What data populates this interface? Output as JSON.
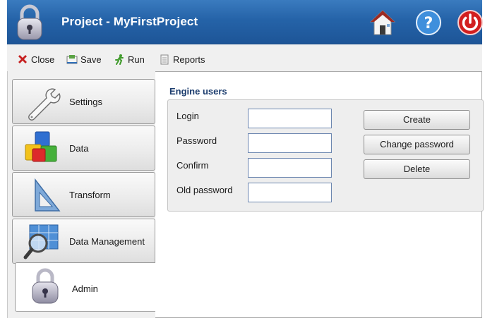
{
  "window": {
    "title": "Project - MyFirstProject",
    "icons": {
      "app": "padlock-icon",
      "home": "home-icon",
      "help": "help-icon",
      "power": "power-icon"
    }
  },
  "toolbar": {
    "close_label": "Close",
    "save_label": "Save",
    "run_label": "Run",
    "reports_label": "Reports"
  },
  "sidebar": {
    "items": [
      {
        "label": "Settings",
        "icon": "wrench-icon"
      },
      {
        "label": "Data",
        "icon": "cubes-icon"
      },
      {
        "label": "Transform",
        "icon": "set-square-icon"
      },
      {
        "label": "Data Management",
        "icon": "magnifier-grid-icon"
      },
      {
        "label": "Admin",
        "icon": "padlock-icon",
        "selected": true
      }
    ]
  },
  "main": {
    "section_title": "Engine users",
    "fields": [
      {
        "label": "Login",
        "value": ""
      },
      {
        "label": "Password",
        "value": ""
      },
      {
        "label": "Confirm",
        "value": ""
      },
      {
        "label": "Old password",
        "value": ""
      }
    ],
    "buttons": {
      "create": "Create",
      "change_password": "Change password",
      "delete": "Delete"
    }
  },
  "colors": {
    "titlebar": "#2563a8",
    "section_title": "#1c3d6e",
    "power": "#d21f1f"
  }
}
